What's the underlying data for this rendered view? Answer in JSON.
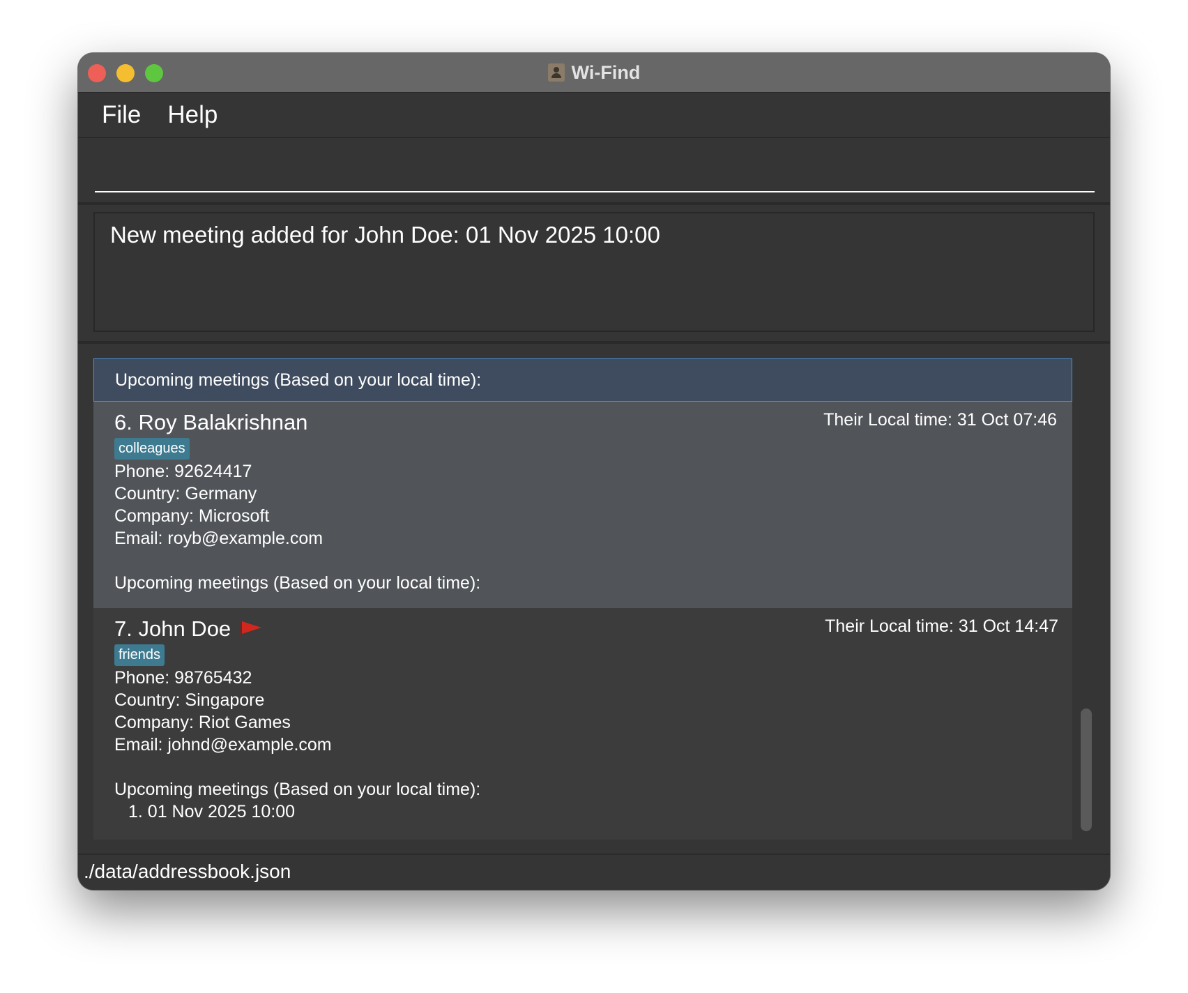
{
  "window": {
    "title": "Wi-Find"
  },
  "menu": {
    "file": "File",
    "help": "Help"
  },
  "command": {
    "value": ""
  },
  "result": {
    "message": "New meeting added for John Doe: 01 Nov 2025 10:00"
  },
  "list": {
    "header": "Upcoming meetings (Based on your local time):",
    "cards": [
      {
        "name": "6. Roy Balakrishnan",
        "local_time": "Their Local time: 31 Oct 07:46",
        "tag": "colleagues",
        "phone": "Phone: 92624417",
        "country": "Country: Germany",
        "company": "Company: Microsoft",
        "email": "Email: royb@example.com",
        "meetings_label": "Upcoming meetings (Based on your local time):",
        "meetings": []
      },
      {
        "name": "7. John Doe",
        "local_time": "Their Local time: 31 Oct 14:47",
        "tag": "friends",
        "phone": "Phone: 98765432",
        "country": "Country: Singapore",
        "company": "Company: Riot Games",
        "email": "Email: johnd@example.com",
        "meetings_label": "Upcoming meetings (Based on your local time):",
        "meetings": [
          "1. 01 Nov 2025 10:00"
        ],
        "flag_icon": "red-flag-icon"
      }
    ]
  },
  "status": {
    "path": "./data/addressbook.json"
  },
  "colors": {
    "window_bg": "#353535",
    "header_highlight": "#3f4c60",
    "selected_card": "#515559",
    "tag_bg": "#3e7b91",
    "flag": "#d0281e"
  }
}
